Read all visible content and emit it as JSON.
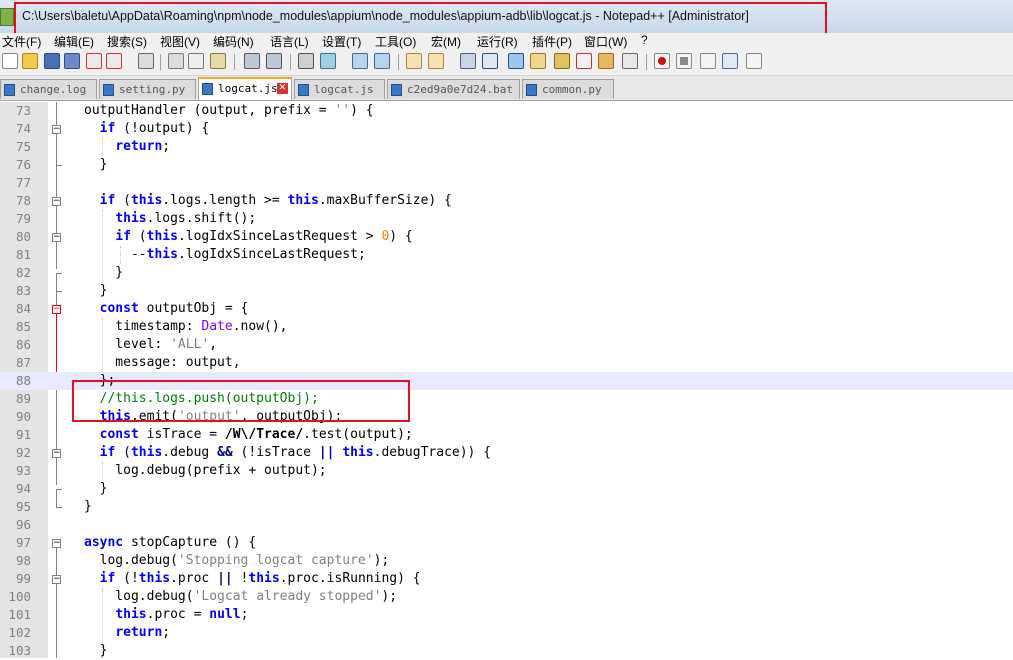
{
  "window": {
    "title": "C:\\Users\\baletu\\AppData\\Roaming\\npm\\node_modules\\appium\\node_modules\\appium-adb\\lib\\logcat.js - Notepad++ [Administrator]"
  },
  "menu": {
    "items": [
      "文件(F)",
      "编辑(E)",
      "搜索(S)",
      "视图(V)",
      "编码(N)",
      "语言(L)",
      "设置(T)",
      "工具(O)",
      "宏(M)",
      "运行(R)",
      "插件(P)",
      "窗口(W)",
      "?"
    ]
  },
  "toolbar": {
    "icons": [
      "new-file-icon",
      "open-file-icon",
      "save-icon",
      "save-all-icon",
      "close-icon",
      "close-all-icon",
      "print-icon",
      "cut-icon",
      "copy-icon",
      "paste-icon",
      "undo-icon",
      "redo-icon",
      "find-icon",
      "replace-icon",
      "zoom-in-icon",
      "zoom-out-icon",
      "sync-vertical-icon",
      "sync-horizontal-icon",
      "word-wrap-icon",
      "show-all-chars-icon",
      "indent-guide-icon",
      "user-language-icon",
      "doc-map-icon",
      "function-list-icon",
      "folder-workspace-icon",
      "monitoring-icon",
      "record-macro-icon",
      "stop-record-icon",
      "play-macro-icon",
      "run-macro-multiple-icon",
      "save-macro-icon"
    ]
  },
  "tabs": [
    {
      "label": "change.log"
    },
    {
      "label": "setting.py"
    },
    {
      "label": "logcat.js",
      "active": true
    },
    {
      "label": "logcat.js"
    },
    {
      "label": "c2ed9a0e7d24.bat"
    },
    {
      "label": "common.py"
    }
  ],
  "tab_close_symbol": "✕",
  "editor": {
    "lines": [
      {
        "n": "73",
        "code": "outputHandler (output, prefix = '') {"
      },
      {
        "n": "74",
        "code": "  if (!output) {"
      },
      {
        "n": "75",
        "code": "    return;"
      },
      {
        "n": "76",
        "code": "  }"
      },
      {
        "n": "77",
        "code": ""
      },
      {
        "n": "78",
        "code": "  if (this.logs.length >= this.maxBufferSize) {"
      },
      {
        "n": "79",
        "code": "    this.logs.shift();"
      },
      {
        "n": "80",
        "code": "    if (this.logIdxSinceLastRequest > 0) {"
      },
      {
        "n": "81",
        "code": "      --this.logIdxSinceLastRequest;"
      },
      {
        "n": "82",
        "code": "    }"
      },
      {
        "n": "83",
        "code": "  }"
      },
      {
        "n": "84",
        "code": "  const outputObj = {"
      },
      {
        "n": "85",
        "code": "    timestamp: Date.now(),"
      },
      {
        "n": "86",
        "code": "    level: 'ALL',"
      },
      {
        "n": "87",
        "code": "    message: output,"
      },
      {
        "n": "88",
        "code": "  };"
      },
      {
        "n": "89",
        "code": "  //this.logs.push(outputObj);"
      },
      {
        "n": "90",
        "code": "  this.emit('output', outputObj);"
      },
      {
        "n": "91",
        "code": "  const isTrace = /W\\/Trace/.test(output);"
      },
      {
        "n": "92",
        "code": "  if (this.debug && (!isTrace || this.debugTrace)) {"
      },
      {
        "n": "93",
        "code": "    log.debug(prefix + output);"
      },
      {
        "n": "94",
        "code": "  }"
      },
      {
        "n": "95",
        "code": "}"
      },
      {
        "n": "96",
        "code": ""
      },
      {
        "n": "97",
        "code": "async stopCapture () {"
      },
      {
        "n": "98",
        "code": "  log.debug('Stopping logcat capture');"
      },
      {
        "n": "99",
        "code": "  if (!this.proc || !this.proc.isRunning) {"
      },
      {
        "n": "100",
        "code": "    log.debug('Logcat already stopped');"
      },
      {
        "n": "101",
        "code": "    this.proc = null;"
      },
      {
        "n": "102",
        "code": "    return;"
      },
      {
        "n": "103",
        "code": "  }"
      }
    ],
    "highlighted_line": "88"
  },
  "colors": {
    "annotation_red": "#e1121d",
    "keyword": "#0000ff",
    "string": "#808080",
    "number": "#ff8000",
    "class": "#8000ff",
    "comment": "#008000",
    "current_line": "#e8e8ff"
  }
}
